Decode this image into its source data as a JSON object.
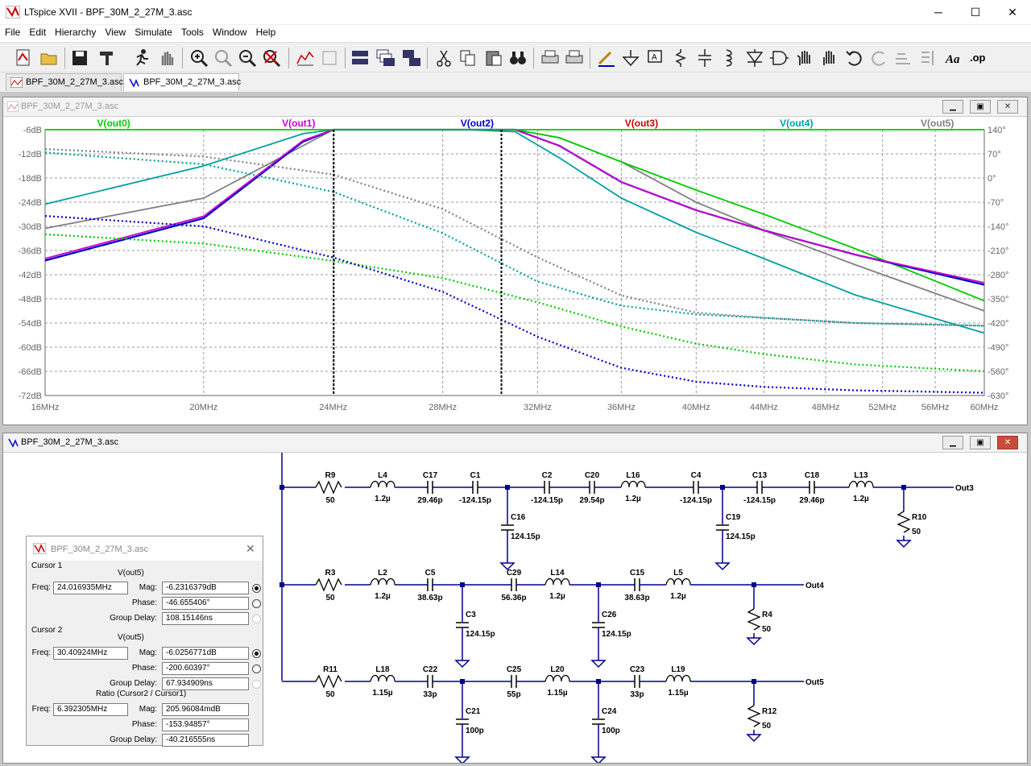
{
  "window": {
    "title": "LTspice XVII - BPF_30M_2_27M_3.asc",
    "minimize": "─",
    "maximize": "☐",
    "close": "✕"
  },
  "menu": [
    "File",
    "Edit",
    "Hierarchy",
    "View",
    "Simulate",
    "Tools",
    "Window",
    "Help"
  ],
  "tabs": [
    {
      "label": "BPF_30M_2_27M_3.asc",
      "icon": "waveform-icon"
    },
    {
      "label": "BPF_30M_2_27M_3.asc",
      "icon": "schematic-icon"
    }
  ],
  "plot": {
    "title": "BPF_30M_2_27M_3.asc",
    "traces": [
      {
        "name": "V(out0)",
        "color": "#00cc00"
      },
      {
        "name": "V(out1)",
        "color": "#cc00cc"
      },
      {
        "name": "V(out2)",
        "color": "#0000cc"
      },
      {
        "name": "V(out3)",
        "color": "#cc0000"
      },
      {
        "name": "V(out4)",
        "color": "#00a0a0"
      },
      {
        "name": "V(out5)",
        "color": "#808080"
      }
    ],
    "y_left": [
      "-6dB",
      "-12dB",
      "-18dB",
      "-24dB",
      "-30dB",
      "-36dB",
      "-42dB",
      "-48dB",
      "-54dB",
      "-60dB",
      "-66dB",
      "-72dB"
    ],
    "y_right": [
      "140°",
      "70°",
      "0°",
      "-70°",
      "-140°",
      "-210°",
      "-280°",
      "-350°",
      "-420°",
      "-490°",
      "-560°",
      "-630°"
    ],
    "x_ticks": [
      "16MHz",
      "20MHz",
      "24MHz",
      "28MHz",
      "32MHz",
      "36MHz",
      "40MHz",
      "44MHz",
      "48MHz",
      "52MHz",
      "56MHz",
      "60MHz"
    ]
  },
  "schematic": {
    "title": "BPF_30M_2_27M_3.asc",
    "row1": {
      "labels": [
        [
          "R9",
          "50"
        ],
        [
          "L4",
          "1.2µ"
        ],
        [
          "C17",
          "29.46p"
        ],
        [
          "C1",
          "-124.15p"
        ],
        [
          "C2",
          "-124.15p"
        ],
        [
          "C20",
          "29.54p"
        ],
        [
          "L16",
          "1.2µ"
        ],
        [
          "C4",
          "-124.15p"
        ],
        [
          "C13",
          "-124.15p"
        ],
        [
          "C18",
          "29.46p"
        ],
        [
          "L13",
          "1.2µ"
        ]
      ],
      "shunts": [
        [
          "C16",
          "124.15p"
        ],
        [
          "C19",
          "124.15p"
        ]
      ],
      "load": [
        "R10",
        "50"
      ],
      "out": "Out3"
    },
    "row2": {
      "labels": [
        [
          "R3",
          "50"
        ],
        [
          "L2",
          "1.2µ"
        ],
        [
          "C5",
          "38.63p"
        ],
        [
          "C29",
          "56.36p"
        ],
        [
          "L14",
          "1.2µ"
        ],
        [
          "C15",
          "38.63p"
        ],
        [
          "L5",
          "1.2µ"
        ]
      ],
      "shunts": [
        [
          "C3",
          "124.15p"
        ],
        [
          "C26",
          "124.15p"
        ]
      ],
      "load": [
        "R4",
        "50"
      ],
      "out": "Out4"
    },
    "row3": {
      "labels": [
        [
          "R11",
          "50"
        ],
        [
          "L18",
          "1.15µ"
        ],
        [
          "C22",
          "33p"
        ],
        [
          "C25",
          "55p"
        ],
        [
          "L20",
          "1.15µ"
        ],
        [
          "C23",
          "33p"
        ],
        [
          "L19",
          "1.15µ"
        ]
      ],
      "shunts": [
        [
          "C21",
          "100p"
        ],
        [
          "C24",
          "100p"
        ]
      ],
      "load": [
        "R12",
        "50"
      ],
      "out": "Out5"
    }
  },
  "cursor_panel": {
    "title": "BPF_30M_2_27M_3.asc",
    "cursor1": {
      "header": "Cursor 1",
      "trace": "V(out5)",
      "freq_label": "Freq:",
      "freq": "24.016935MHz",
      "mag_label": "Mag:",
      "mag": "-6.2316379dB",
      "phase_label": "Phase:",
      "phase": "-46.655406°",
      "gd_label": "Group Delay:",
      "gd": "108.15146ns"
    },
    "cursor2": {
      "header": "Cursor 2",
      "trace": "V(out5)",
      "freq_label": "Freq:",
      "freq": "30.40924MHz",
      "mag_label": "Mag:",
      "mag": "-6.0256771dB",
      "phase_label": "Phase:",
      "phase": "-200.60397°",
      "gd_label": "Group Delay:",
      "gd": "67.934909ns"
    },
    "ratio": {
      "header": "Ratio (Cursor2 / Cursor1)",
      "freq_label": "Freq:",
      "freq": "6.392305MHz",
      "mag_label": "Mag:",
      "mag": "205.96084mdB",
      "phase_label": "Phase:",
      "phase": "-153.94857°",
      "gd_label": "Group Delay:",
      "gd": "-40.216555ns"
    }
  }
}
